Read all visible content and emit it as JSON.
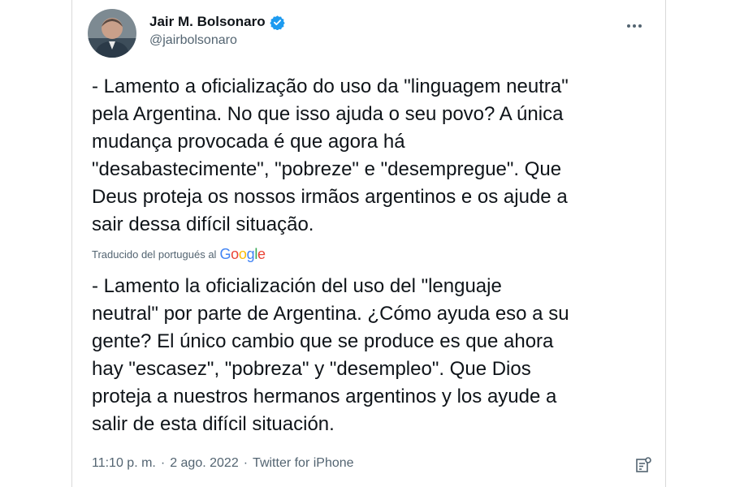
{
  "author": {
    "display_name": "Jair M. Bolsonaro",
    "handle": "@jairbolsonaro",
    "verified": true
  },
  "tweet": {
    "original_text": "- Lamento a oficialização do uso da \"linguagem neutra\"\npela Argentina. No que isso ajuda o seu povo? A única\nmudança provocada é que agora há\n\"desabastecimente\", \"pobreze\" e \"desempregue\". Que\nDeus proteja os nossos irmãos argentinos e os ajude a\nsair dessa difícil situação.",
    "translation_note": "Traducido del portugués al",
    "translation_provider": "Google",
    "translated_text": "- Lamento la oficialización del uso del \"lenguaje\nneutral\" por parte de Argentina. ¿Cómo ayuda eso a su\ngente? El único cambio que se produce es que ahora\nhay \"escasez\", \"pobreza\" y \"desempleo\". Que Dios\nproteja a nuestros hermanos argentinos y los ayude a\nsalir de esta difícil situación.",
    "time": "11:10 p. m.",
    "separator": "·",
    "date": "2 ago. 2022",
    "source": "Twitter for iPhone"
  },
  "icons": {
    "verified": "verified-badge-icon",
    "more": "more-options-icon",
    "analytics": "analytics-icon"
  },
  "colors": {
    "text": "#0f1419",
    "secondary": "#536471",
    "verified": "#1d9bf0"
  }
}
